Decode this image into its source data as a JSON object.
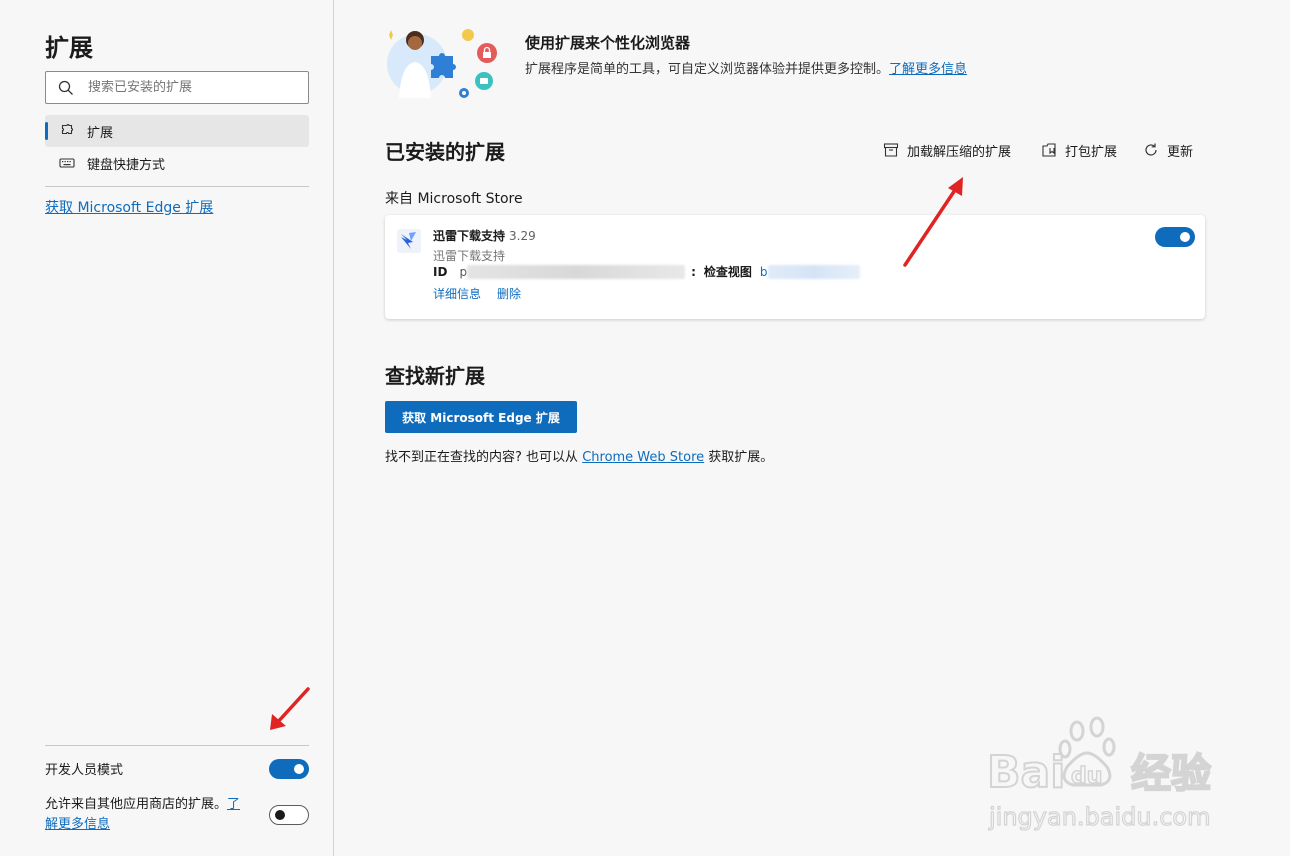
{
  "sidebar": {
    "title": "扩展",
    "search_placeholder": "搜索已安装的扩展",
    "items": [
      {
        "label": "扩展",
        "active": true
      },
      {
        "label": "键盘快捷方式",
        "active": false
      }
    ],
    "get_link": "获取 Microsoft Edge 扩展",
    "dev_mode_label": "开发人员模式",
    "dev_mode_on": true,
    "other_stores_label": "允许来自其他应用商店的扩展。",
    "other_stores_link_1": "了",
    "other_stores_link_2": "解更多信息",
    "other_stores_on": false
  },
  "hero": {
    "title": "使用扩展来个性化浏览器",
    "desc": "扩展程序是简单的工具，可自定义浏览器体验并提供更多控制。",
    "learn_more": "了解更多信息"
  },
  "installed": {
    "title": "已安装的扩展",
    "load_unpacked": "加载解压缩的扩展",
    "pack": "打包扩展",
    "update": "更新",
    "source": "来自 Microsoft Store",
    "extension": {
      "name": "迅雷下载支持",
      "version": "3.29",
      "desc": "迅雷下载支持",
      "id_label": "ID",
      "id_value_prefix": "p",
      "inspect_label": "检查视图",
      "inspect_value_prefix": "b",
      "details": "详细信息",
      "remove": "删除",
      "enabled": true
    }
  },
  "find": {
    "title": "查找新扩展",
    "button": "获取 Microsoft Edge 扩展",
    "note_prefix": "找不到正在查找的内容? 也可以从",
    "note_link": "Chrome Web Store",
    "note_suffix": "获取扩展。"
  },
  "watermark": {
    "brand_latin": "Bai",
    "brand_du": "du",
    "brand_cn": "经验",
    "url": "jingyan.baidu.com"
  },
  "colors": {
    "accent": "#0f6cbd",
    "annotation_arrow": "#e02424"
  }
}
